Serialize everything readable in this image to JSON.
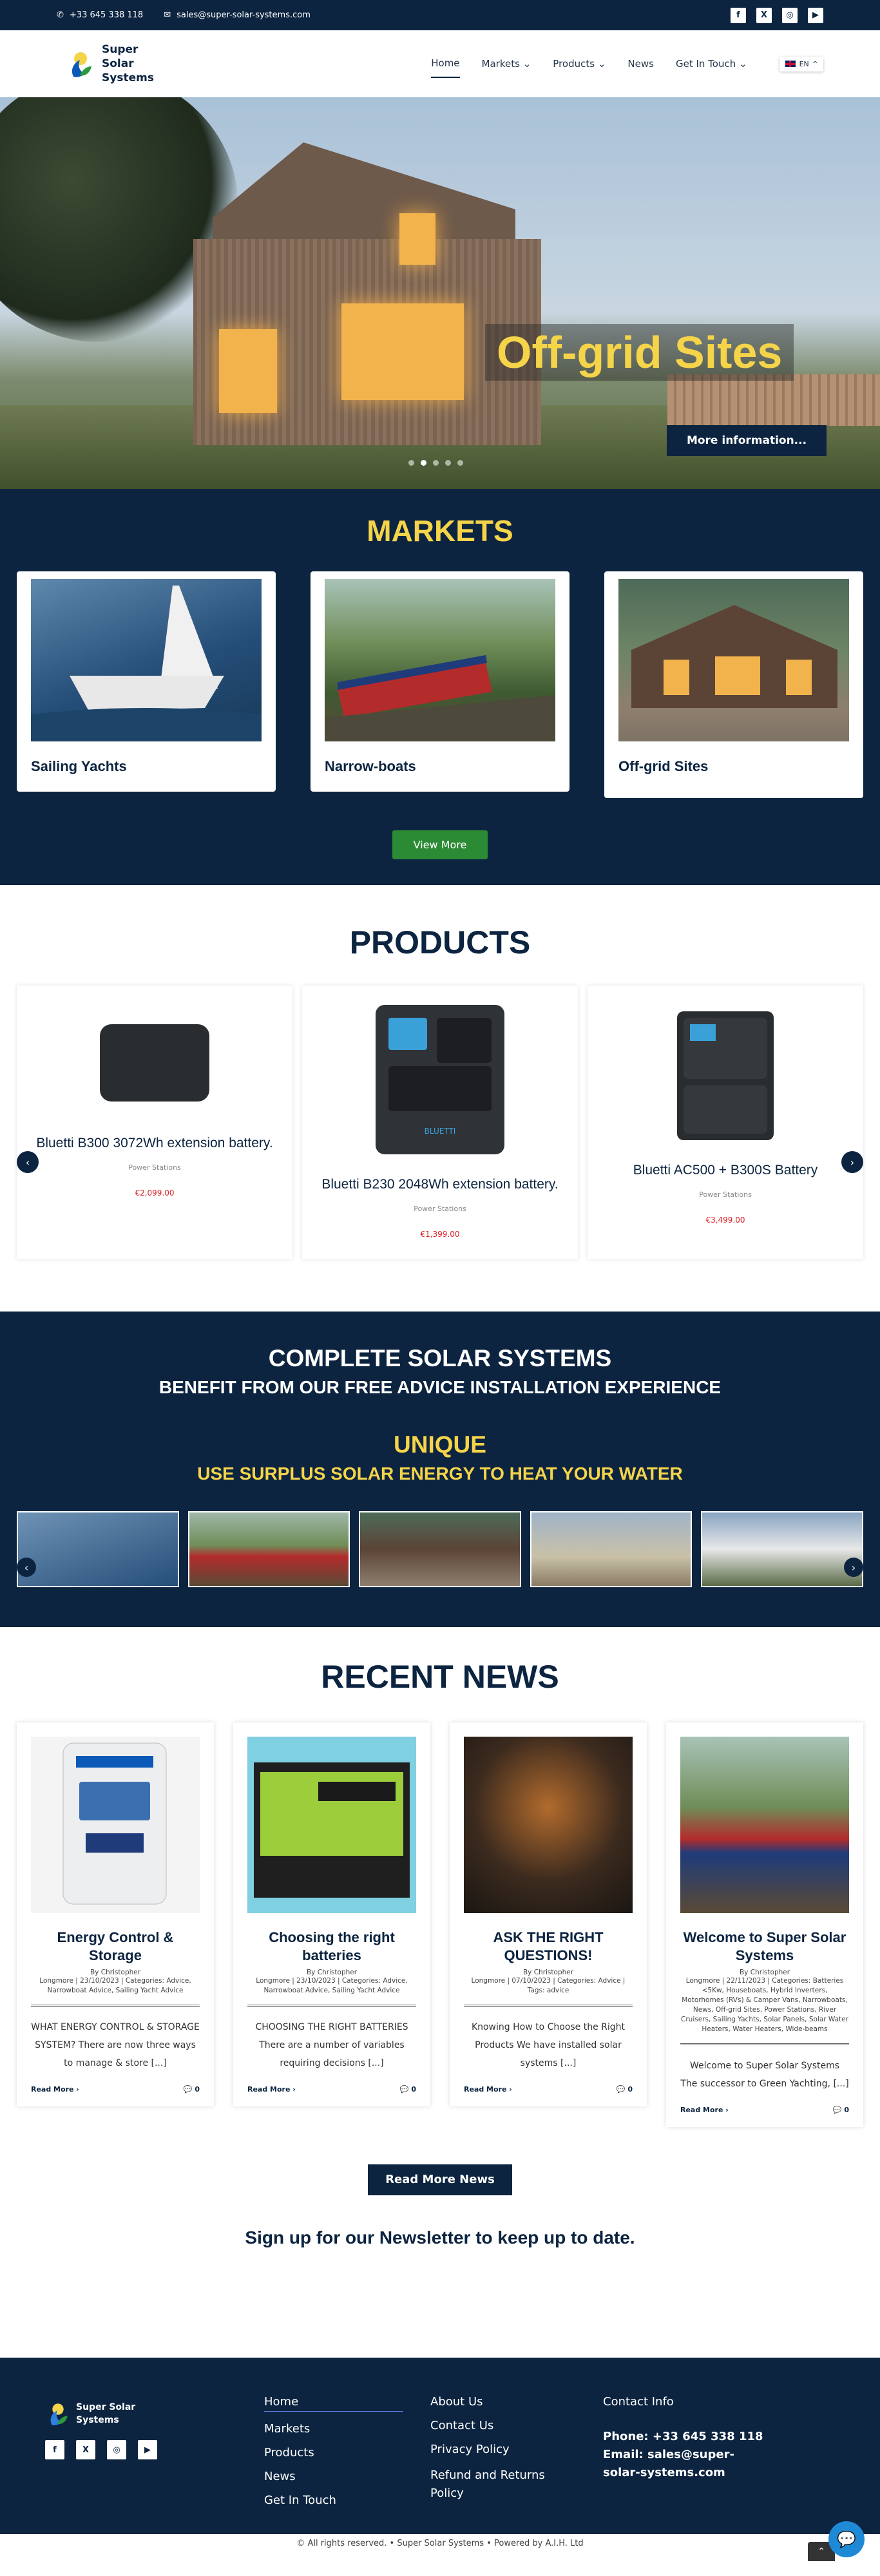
{
  "topbar": {
    "phone": "+33 645 338 118",
    "email": "sales@super-solar-systems.com"
  },
  "logo": {
    "name": "Super Solar Systems"
  },
  "nav": {
    "items": [
      "Home",
      "Markets",
      "Products",
      "News",
      "Get In Touch"
    ],
    "lang": "EN"
  },
  "hero": {
    "title": "Off-grid Sites",
    "button": "More information..."
  },
  "markets": {
    "heading": "MARKETS",
    "cards": [
      "Sailing Yachts",
      "Narrow-boats",
      "Off-grid Sites"
    ],
    "button": "View More"
  },
  "products": {
    "heading": "PRODUCTS",
    "items": [
      {
        "name": "Bluetti B300 3072Wh extension battery.",
        "category": "Power Stations",
        "price": "€2,099.00"
      },
      {
        "name": "Bluetti B230 2048Wh extension battery.",
        "category": "Power Stations",
        "price": "€1,399.00"
      },
      {
        "name": "Bluetti AC500 + B300S Battery",
        "category": "Power Stations",
        "price": "€3,499.00"
      }
    ]
  },
  "complete": {
    "line1": "COMPLETE SOLAR SYSTEMS",
    "line2": "BENEFIT FROM OUR FREE ADVICE INSTALLATION EXPERIENCE",
    "line3": "UNIQUE",
    "line4": "USE SURPLUS SOLAR ENERGY TO HEAT YOUR WATER"
  },
  "news": {
    "heading": "RECENT NEWS",
    "posts": [
      {
        "title": "Energy Control & Storage",
        "by": "By Christopher",
        "meta": "Longmore | 23/10/2023 | Categories: Advice, Narrowboat Advice, Sailing Yacht Advice",
        "excerpt": "WHAT ENERGY CONTROL & STORAGE SYSTEM? There are now three ways to manage & store [...]",
        "more": "Read More",
        "comments": "0"
      },
      {
        "title": "Choosing the right batteries",
        "by": "By Christopher",
        "meta": "Longmore | 23/10/2023 | Categories: Advice, Narrowboat Advice, Sailing Yacht Advice",
        "excerpt": "CHOOSING THE RIGHT BATTERIES There are a number of variables requiring decisions [...]",
        "more": "Read More",
        "comments": "0"
      },
      {
        "title": "ASK THE RIGHT QUESTIONS!",
        "by": "By Christopher",
        "meta": "Longmore | 07/10/2023 | Categories: Advice | Tags: advice",
        "excerpt": "Knowing How to Choose the Right Products We have installed solar systems [...]",
        "more": "Read More",
        "comments": "0"
      },
      {
        "title": "Welcome to Super Solar Systems",
        "by": "By Christopher",
        "meta": "Longmore | 22/11/2023 | Categories: Batteries <5Kw, Houseboats, Hybrid Inverters, Motorhomes (RVs) & Camper Vans, Narrowboats, News, Off-grid Sites, Power Stations, River Cruisers, Sailing Yachts, Solar Panels, Solar Water Heaters, Water Heaters, Wide-beams",
        "excerpt": "Welcome to Super Solar Systems The successor to Green Yachting, [...]",
        "more": "Read More",
        "comments": "0"
      }
    ],
    "button": "Read More News",
    "newsletter": "Sign up for our Newsletter to keep up to date."
  },
  "footer": {
    "col1": [
      "Home",
      "Markets",
      "Products",
      "News",
      "Get In Touch"
    ],
    "col2": [
      "About Us",
      "Contact Us",
      "Privacy Policy",
      "Refund and Returns Policy"
    ],
    "col3_title": "Contact Info",
    "phone": "Phone: +33 645 338 118",
    "email": "Email: sales@super-solar-systems.com",
    "copyright": "© All rights reserved. • Super Solar Systems • Powered by A.I.H. Ltd"
  }
}
